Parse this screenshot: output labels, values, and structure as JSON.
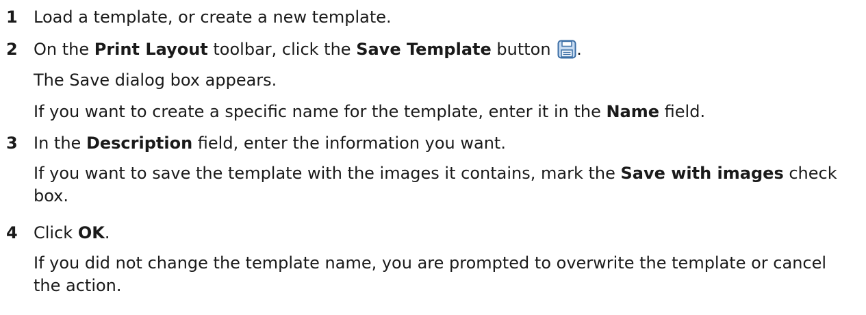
{
  "steps": [
    {
      "number": "1",
      "instruction": "Load a template, or create a new template."
    },
    {
      "number": "2",
      "instruction": {
        "t1": "On the ",
        "b1": "Print Layout",
        "t2": " toolbar, click the ",
        "b2": "Save Template",
        "t3": " button ",
        "t4": "."
      },
      "icon": "save-floppy-icon",
      "notes": [
        "The Save dialog box appears.",
        {
          "t1": "If you want to create a specific name for the template, enter it in the ",
          "b1": "Name",
          "t2": " field."
        }
      ]
    },
    {
      "number": "3",
      "instruction": {
        "t1": "In the ",
        "b1": "Description",
        "t2": " field, enter the information you want."
      },
      "notes": [
        {
          "t1": "If you want to save the template with the images it contains, mark the ",
          "b1": "Save with images",
          "t2": " check box."
        }
      ]
    },
    {
      "number": "4",
      "instruction": {
        "t1": "Click ",
        "b1": "OK",
        "t2": "."
      },
      "notes": [
        "If you did not change the template name, you are prompted to overwrite the template or cancel the action."
      ]
    }
  ],
  "colors": {
    "text": "#1a1a1a",
    "icon_fill": "#c8dcf2",
    "icon_stroke": "#3b6ea5"
  }
}
